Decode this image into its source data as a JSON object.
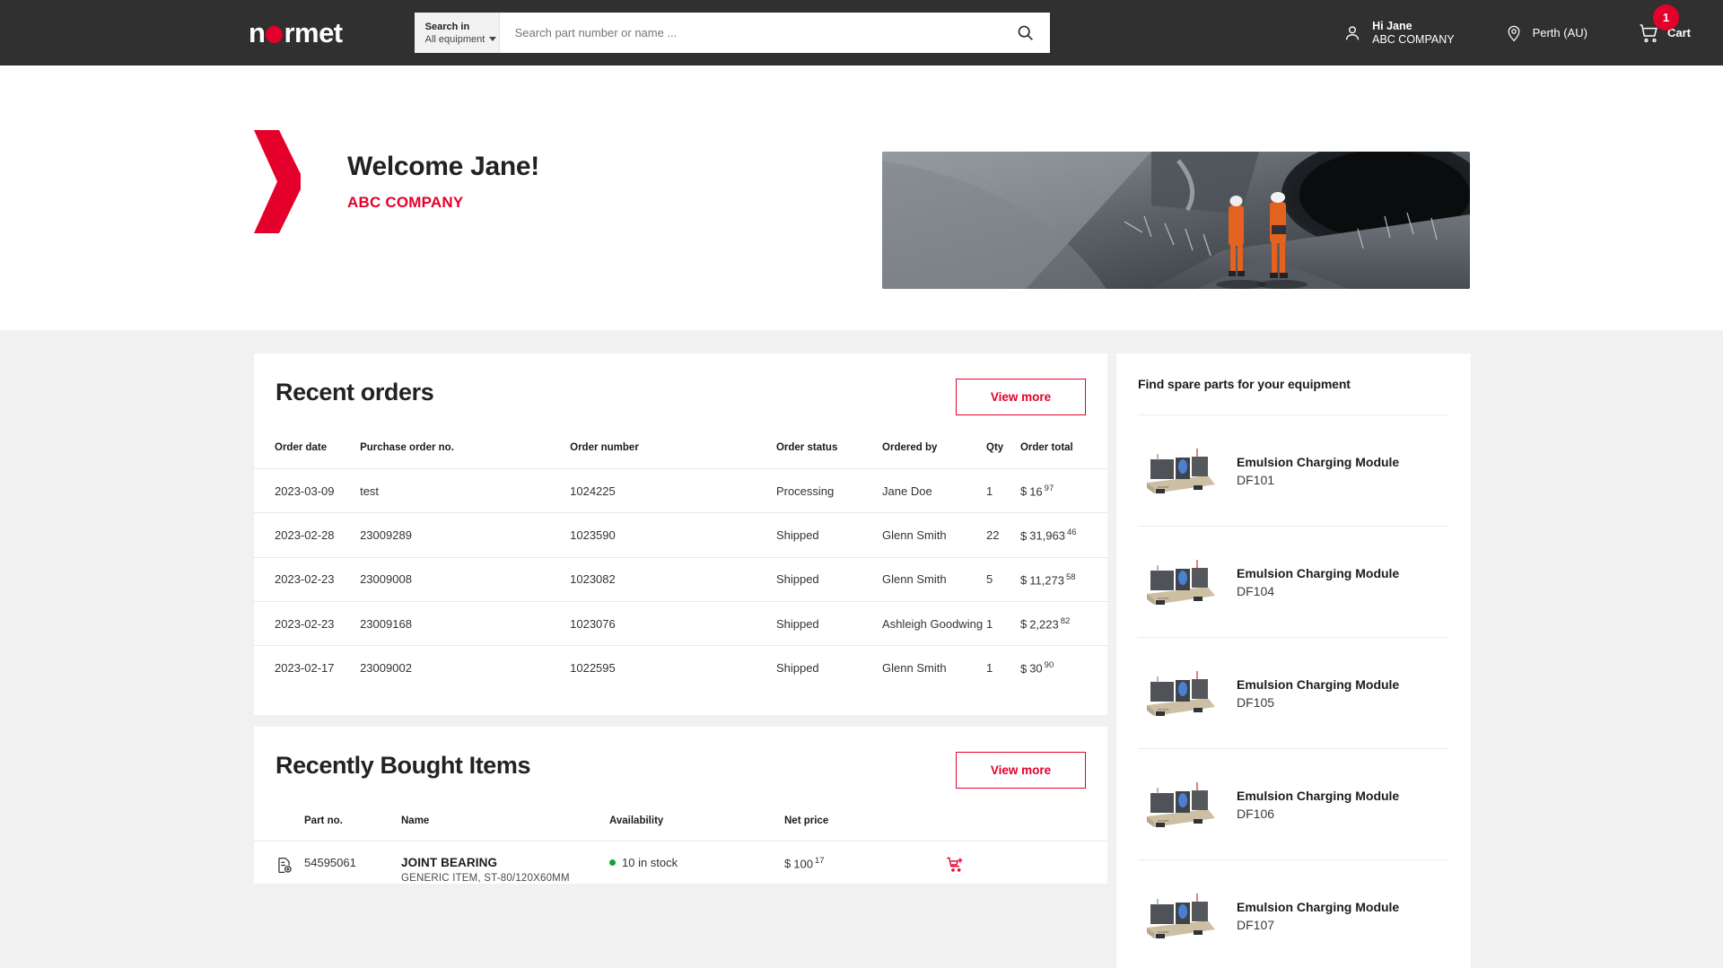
{
  "header": {
    "logo_text_before": "n",
    "logo_icon": "red-o-dot",
    "logo_text_after": "rmet",
    "search": {
      "scope_label": "Search in",
      "scope_value": "All equipment",
      "placeholder": "Search part number or name ...",
      "value": "",
      "search_icon": "search-icon"
    },
    "user": {
      "greeting": "Hi Jane",
      "company": "ABC COMPANY",
      "icon": "user-icon"
    },
    "location": {
      "text": "Perth (AU)",
      "icon": "location-pin-icon"
    },
    "cart": {
      "label": "Cart",
      "count": "1",
      "icon": "shopping-cart-icon"
    }
  },
  "welcome": {
    "title": "Welcome Jane!",
    "company": "ABC COMPANY",
    "chevron_icon": "red-chevron-icon",
    "hero_alt": "tunnel-workers-photo"
  },
  "recent_orders": {
    "title": "Recent orders",
    "view_more_label": "View more",
    "columns": [
      "Order date",
      "Purchase order no.",
      "Order number",
      "Order status",
      "Ordered by",
      "Qty",
      "Order total"
    ],
    "rows": [
      {
        "date": "2023-03-09",
        "po": "test",
        "number": "1024225",
        "status": "Processing",
        "by": "Jane Doe",
        "qty": "1",
        "currency": "$",
        "amount": "16",
        "cents": "97"
      },
      {
        "date": "2023-02-28",
        "po": "23009289",
        "number": "1023590",
        "status": "Shipped",
        "by": "Glenn Smith",
        "qty": "22",
        "currency": "$",
        "amount": "31,963",
        "cents": "46"
      },
      {
        "date": "2023-02-23",
        "po": "23009008",
        "number": "1023082",
        "status": "Shipped",
        "by": "Glenn Smith",
        "qty": "5",
        "currency": "$",
        "amount": "11,273",
        "cents": "58"
      },
      {
        "date": "2023-02-23",
        "po": "23009168",
        "number": "1023076",
        "status": "Shipped",
        "by": "Ashleigh Goodwing",
        "qty": "1",
        "currency": "$",
        "amount": "2,223",
        "cents": "82"
      },
      {
        "date": "2023-02-17",
        "po": "23009002",
        "number": "1022595",
        "status": "Shipped",
        "by": "Glenn Smith",
        "qty": "1",
        "currency": "$",
        "amount": "30",
        "cents": "90"
      }
    ]
  },
  "recently_bought": {
    "title": "Recently Bought Items",
    "view_more_label": "View more",
    "columns": [
      "Part no.",
      "Name",
      "Availability",
      "Net price"
    ],
    "rows": [
      {
        "doc_icon": "document-add-icon",
        "part_no": "54595061",
        "name": "JOINT BEARING",
        "description": "GENERIC ITEM, ST-80/120X60MM",
        "availability": "10 in stock",
        "currency": "$",
        "amount": "100",
        "cents": "17",
        "cart_icon": "add-to-cart-icon"
      }
    ]
  },
  "spare_parts": {
    "title": "Find spare parts for your equipment",
    "items": [
      {
        "name": "Emulsion Charging Module",
        "model": "DF101",
        "thumb": "equipment-photo"
      },
      {
        "name": "Emulsion Charging Module",
        "model": "DF104",
        "thumb": "equipment-photo"
      },
      {
        "name": "Emulsion Charging Module",
        "model": "DF105",
        "thumb": "equipment-photo"
      },
      {
        "name": "Emulsion Charging Module",
        "model": "DF106",
        "thumb": "equipment-photo"
      },
      {
        "name": "Emulsion Charging Module",
        "model": "DF107",
        "thumb": "equipment-photo"
      }
    ]
  },
  "colors": {
    "brand_red": "#e4002b",
    "header_bg": "#303030",
    "page_bg": "#f1f1f1",
    "stock_green": "#13a438"
  }
}
